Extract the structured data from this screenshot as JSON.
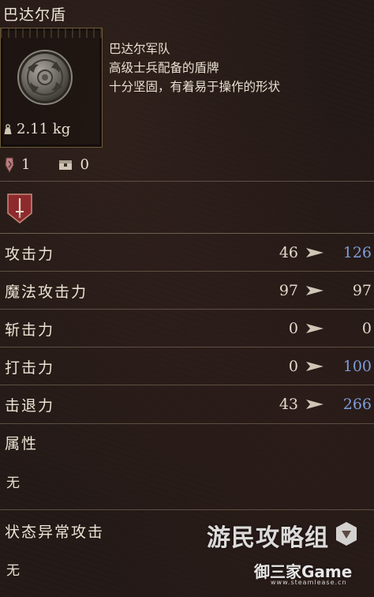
{
  "item": {
    "name": "巴达尔盾",
    "weight": "2.11 kg",
    "description": [
      "巴达尔军队",
      "高级士兵配备的盾牌",
      "十分坚固，有着易于操作的形状"
    ],
    "count_a": "1",
    "count_b": "0"
  },
  "stats": [
    {
      "label": "攻击力",
      "base": "46",
      "new": "126",
      "improved": true
    },
    {
      "label": "魔法攻击力",
      "base": "97",
      "new": "97",
      "improved": false
    },
    {
      "label": "斩击力",
      "base": "0",
      "new": "0",
      "improved": false
    },
    {
      "label": "打击力",
      "base": "0",
      "new": "100",
      "improved": true
    },
    {
      "label": "击退力",
      "base": "43",
      "new": "266",
      "improved": true
    }
  ],
  "sections": {
    "attribute": {
      "label": "属性",
      "value": "无"
    },
    "status_attack": {
      "label": "状态异常攻击",
      "value": "无"
    }
  },
  "watermark": {
    "line1": "游民攻略组",
    "line2": "御三家Game",
    "line3": "www.steamlease.cn"
  },
  "icons": {
    "weight": "weight-icon",
    "count_a": "shield-slot-icon",
    "count_b": "chest-icon",
    "weapon_type": "sword-badge-icon",
    "arrow": "arrow-right-icon"
  },
  "colors": {
    "improved_value": "#7e9dd9",
    "normal_value": "#e2dacb",
    "badge_red": "#8e2a2e"
  }
}
